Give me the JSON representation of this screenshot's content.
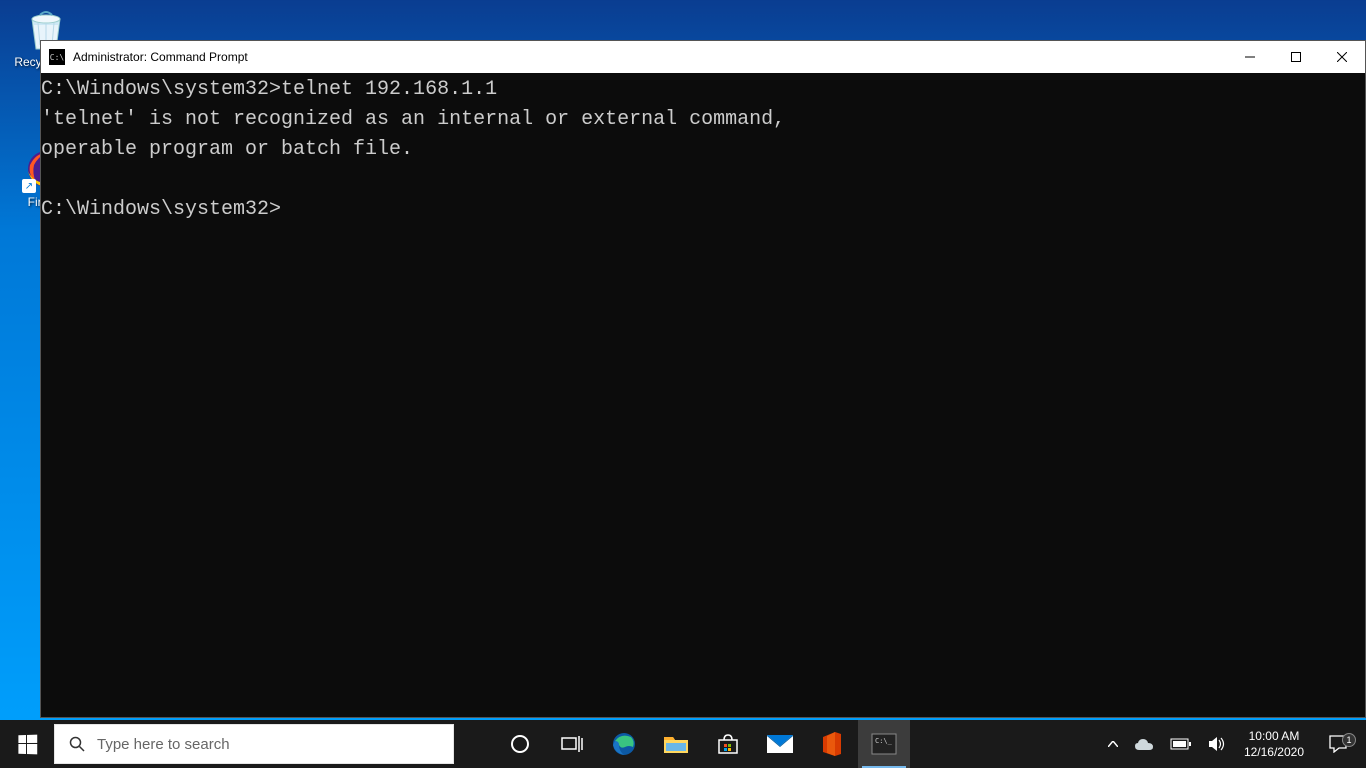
{
  "desktop": {
    "recycle_bin": "Recycle Bin",
    "firefox": "Firefox"
  },
  "cmd": {
    "title": "Administrator: Command Prompt",
    "line1": "C:\\Windows\\system32>telnet 192.168.1.1",
    "line2": "'telnet' is not recognized as an internal or external command,",
    "line3": "operable program or batch file.",
    "line4": "",
    "line5": "C:\\Windows\\system32>"
  },
  "taskbar": {
    "search_placeholder": "Type here to search",
    "time": "10:00 AM",
    "date": "12/16/2020",
    "notif_count": "1"
  }
}
